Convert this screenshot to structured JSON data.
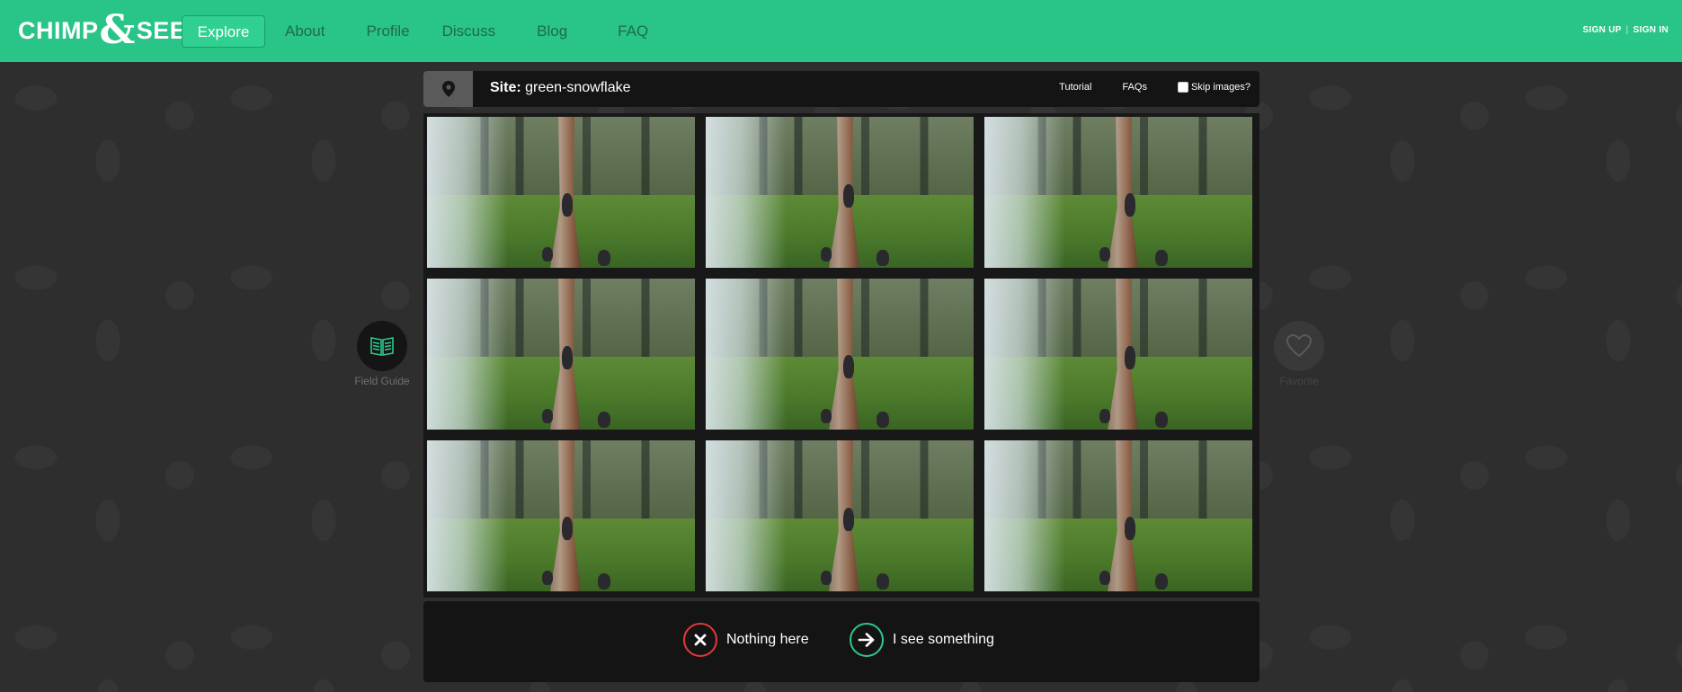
{
  "brand": {
    "left": "CHIMP",
    "amp": "&",
    "right": "SEE"
  },
  "nav": {
    "items": [
      {
        "label": "Explore",
        "active": true
      },
      {
        "label": "About"
      },
      {
        "label": "Profile"
      },
      {
        "label": "Discuss"
      },
      {
        "label": "Blog"
      },
      {
        "label": "FAQ"
      }
    ]
  },
  "auth": {
    "sign_up": "SIGN UP",
    "separator": "|",
    "sign_in": "SIGN IN"
  },
  "site": {
    "prefix": "Site:",
    "name": "green-snowflake",
    "tutorial": "Tutorial",
    "faqs": "FAQs",
    "skip_images": "Skip images?"
  },
  "side": {
    "field_guide": "Field Guide",
    "favorite": "Favorite"
  },
  "actions": {
    "nothing": "Nothing here",
    "something": "I see something"
  },
  "colors": {
    "brand_green": "#29c487",
    "nothing_red": "#e03a3a",
    "something_green": "#2ec98a"
  },
  "grid": {
    "rows": 3,
    "cols": 3
  }
}
